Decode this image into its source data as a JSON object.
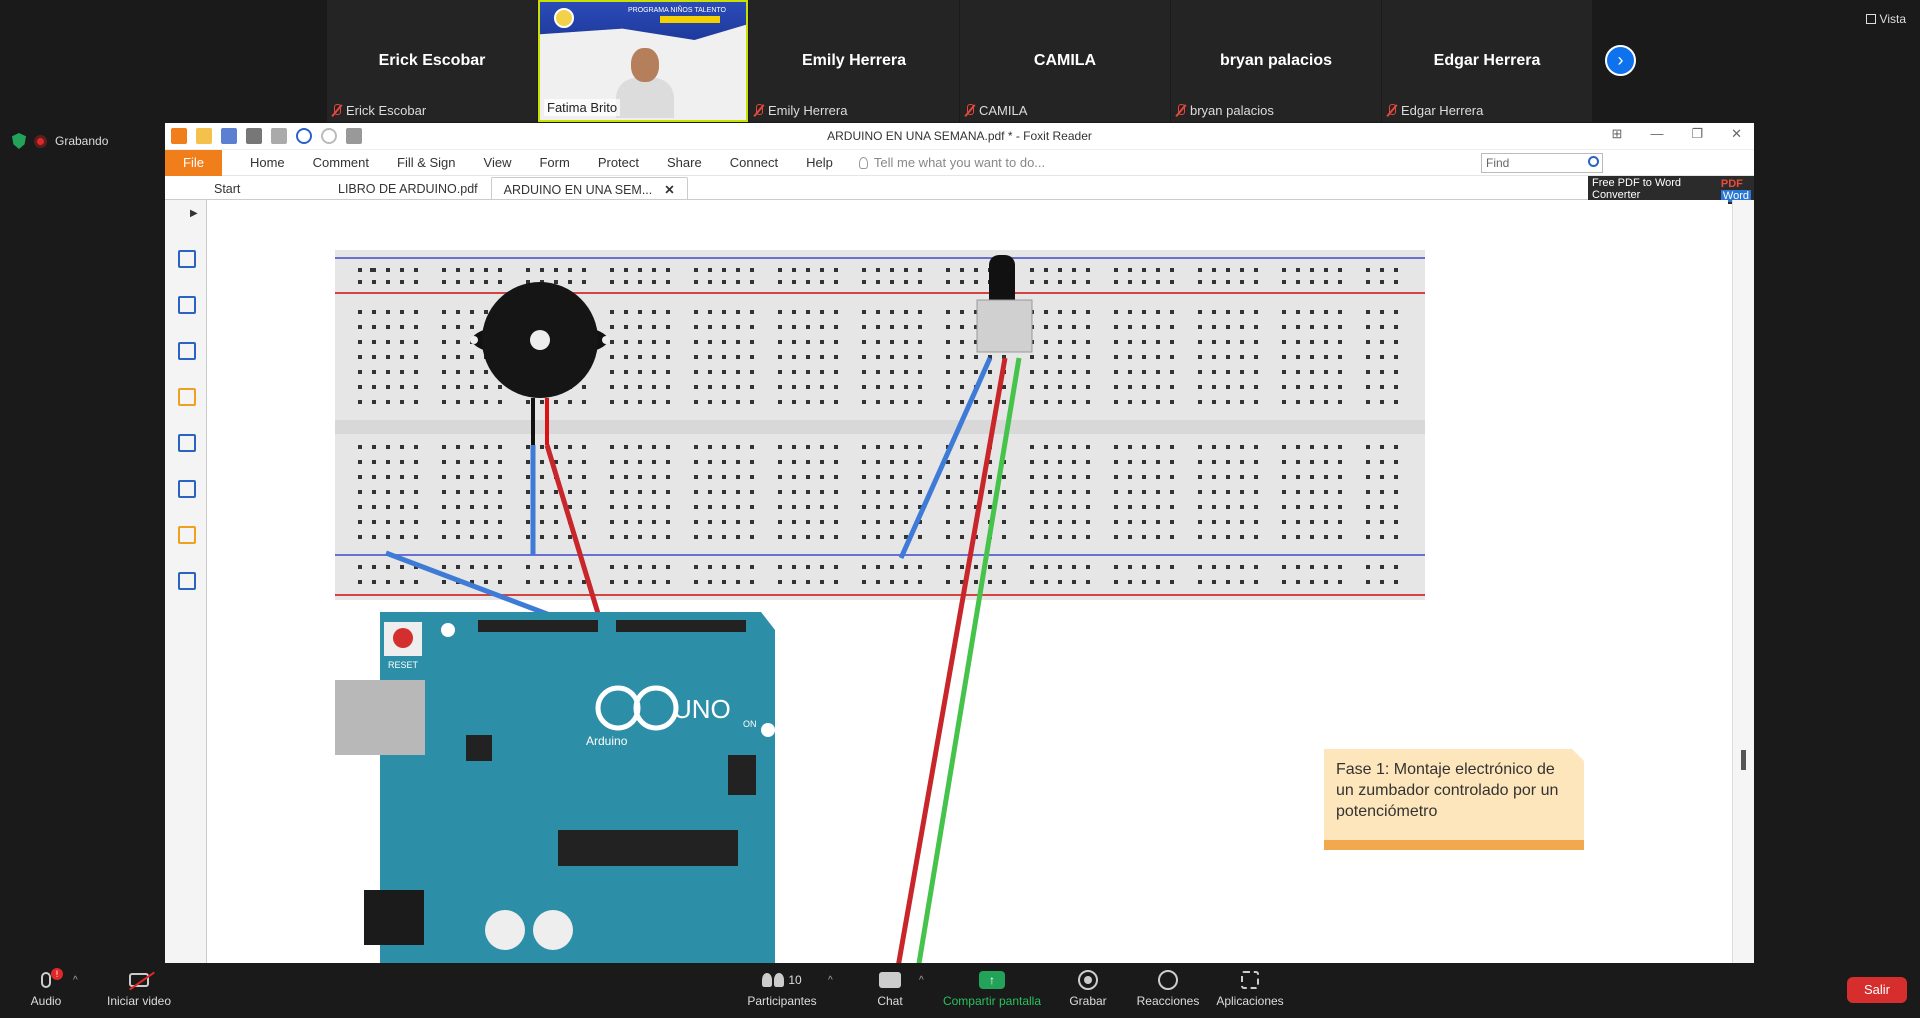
{
  "participants": [
    {
      "big": "Erick Escobar",
      "small": "Erick Escobar"
    },
    {
      "small": "Fatima Brito"
    },
    {
      "big": "Emily Herrera",
      "small": "Emily Herrera"
    },
    {
      "big": "CAMILA",
      "small": "CAMILA"
    },
    {
      "big": "bryan palacios",
      "small": "bryan palacios"
    },
    {
      "big": "Edgar Herrera",
      "small": "Edgar Herrera"
    }
  ],
  "video_banner": "PROGRAMA NIÑOS TALENTO",
  "view_label": "Vista",
  "recording_label": "Grabando",
  "foxit": {
    "title": "ARDUINO EN UNA SEMANA.pdf * - Foxit Reader",
    "menu": [
      "File",
      "Home",
      "Comment",
      "Fill & Sign",
      "View",
      "Form",
      "Protect",
      "Share",
      "Connect",
      "Help"
    ],
    "tell_me": "Tell me what you want to do...",
    "find_placeholder": "Find",
    "tabs": [
      "Start",
      "LIBRO DE ARDUINO.pdf",
      "ARDUINO EN UNA SEM..."
    ],
    "promo_line1": "Free PDF to Word",
    "promo_line2": "Converter",
    "promo_pdf": "PDF",
    "promo_word": "Word"
  },
  "diagram": {
    "callout": "Fase 1: Montaje electrónico de un zumbador controlado por un potenciómetro",
    "board_logo": "UNO",
    "board_name": "Arduino",
    "reset_label": "RESET",
    "on_label": "ON"
  },
  "toolbar": {
    "audio": "Audio",
    "audio_badge": "!",
    "video": "Iniciar video",
    "participants_count": "10",
    "participants": "Participantes",
    "chat": "Chat",
    "share": "Compartir pantalla",
    "record": "Grabar",
    "reactions": "Reacciones",
    "apps": "Aplicaciones",
    "leave": "Salir"
  }
}
